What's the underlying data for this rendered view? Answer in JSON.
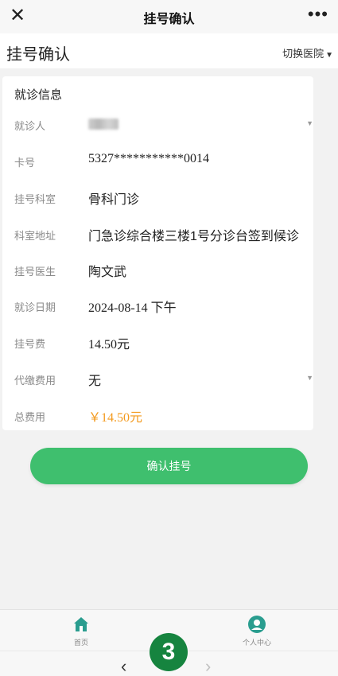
{
  "topbar": {
    "title": "挂号确认",
    "close_glyph": "✕",
    "more_glyph": "•••"
  },
  "header": {
    "title": "挂号确认",
    "switch_label": "切换医院",
    "switch_caret": "▼"
  },
  "section_title": "就诊信息",
  "fields": [
    {
      "label": "就诊人",
      "value": "",
      "blurred": true,
      "dropdown": true
    },
    {
      "label": "卡号",
      "value": "5327***********0014"
    },
    {
      "label": "挂号科室",
      "value": "骨科门诊"
    },
    {
      "label": "科室地址",
      "value": "门急诊综合楼三楼1号分诊台签到候诊"
    },
    {
      "label": "挂号医生",
      "value": "陶文武"
    },
    {
      "label": "就诊日期",
      "value": "2024-08-14 下午"
    },
    {
      "label": "挂号费",
      "value": "14.50元"
    },
    {
      "label": "代缴费用",
      "value": "无",
      "dropdown": true
    },
    {
      "label": "总费用",
      "value": "￥14.50元",
      "color": "#f39a1e"
    }
  ],
  "confirm_label": "确认挂号",
  "tabs": [
    {
      "label": "首页",
      "icon": "home-icon"
    },
    {
      "label": "个人中心",
      "icon": "user-center-icon"
    }
  ],
  "nav": {
    "back_glyph": "‹",
    "forward_glyph": "›"
  },
  "badge": "3",
  "colors": {
    "accent": "#3fbf6e",
    "orange": "#f39a1e",
    "badge": "#16843f"
  }
}
